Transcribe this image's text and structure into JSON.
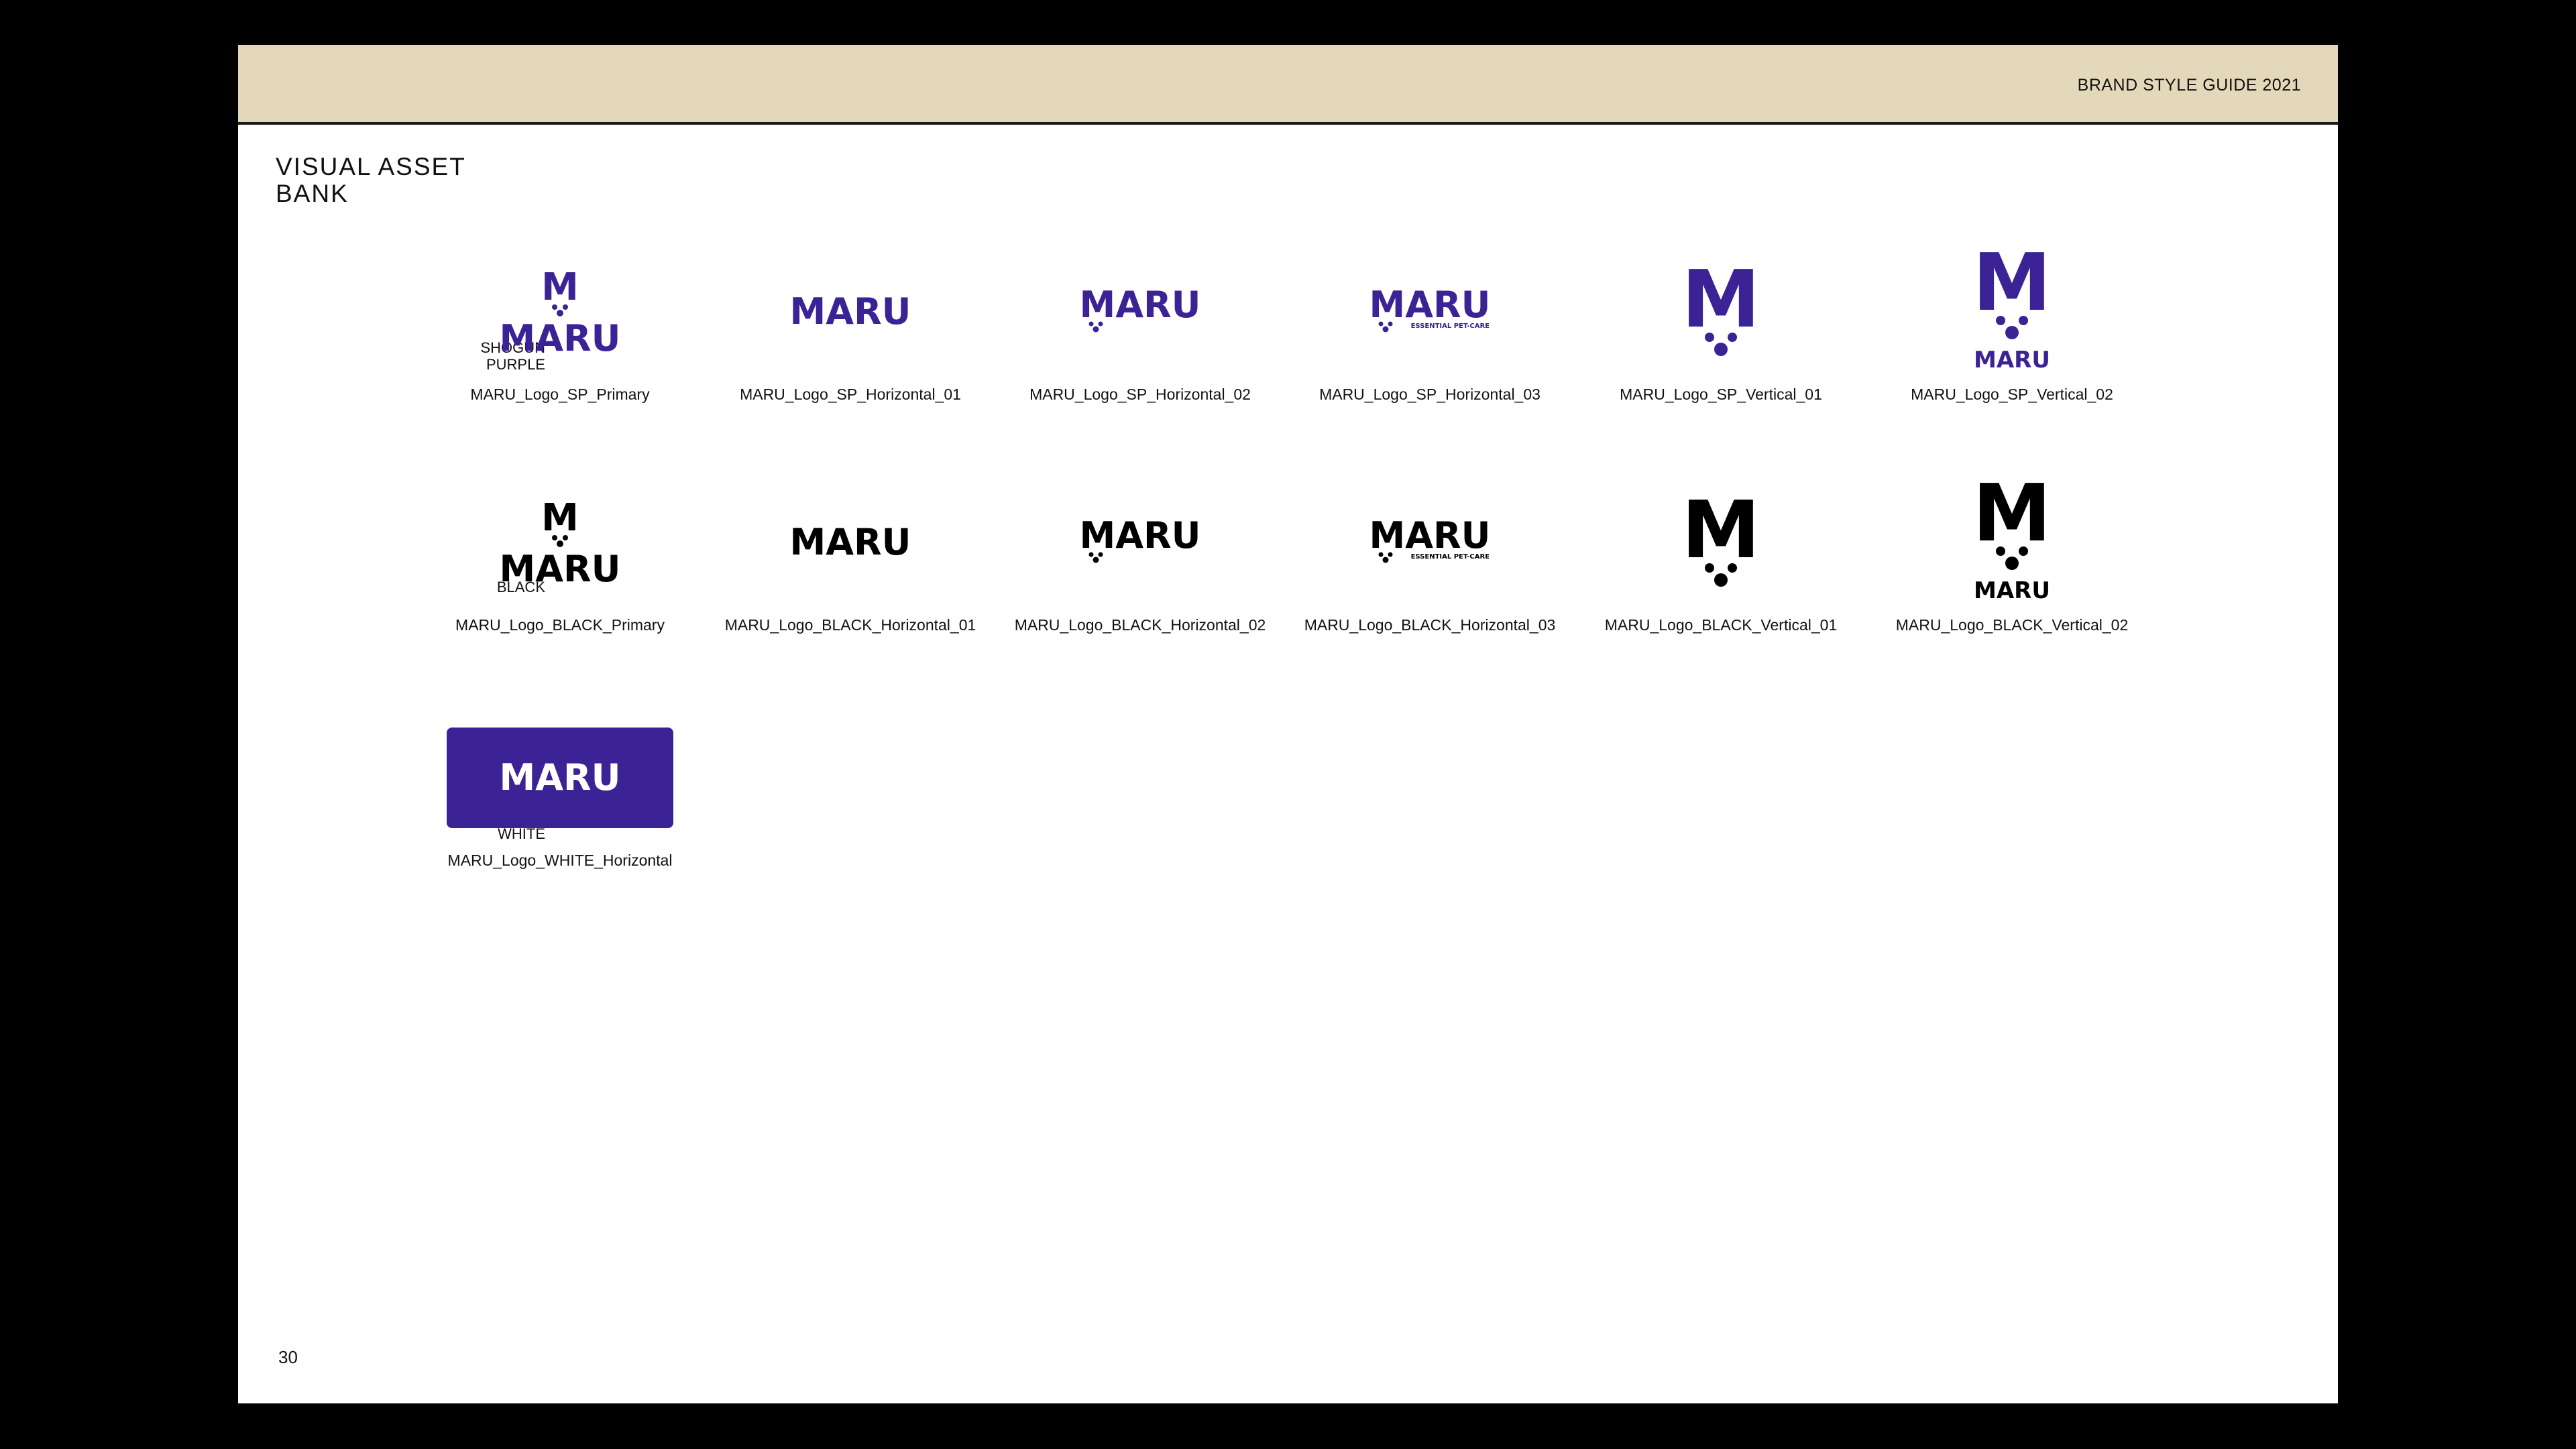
{
  "header": {
    "title": "BRAND STYLE GUIDE 2021"
  },
  "page": {
    "title_line1": "VISUAL ASSET",
    "title_line2": "BANK",
    "number": "30"
  },
  "colors": {
    "purple": "#3b2396",
    "black": "#000000",
    "band": "#e3d8b9"
  },
  "logo": {
    "wordmark": "MARU",
    "initial": "M",
    "tagline": "ESSENTIAL PET-CARE"
  },
  "rows": {
    "purple": {
      "label_line1": "SHŌGUN",
      "label_line2": "PURPLE",
      "captions": [
        "MARU_Logo_SP_Primary",
        "MARU_Logo_SP_Horizontal_01",
        "MARU_Logo_SP_Horizontal_02",
        "MARU_Logo_SP_Horizontal_03",
        "MARU_Logo_SP_Vertical_01",
        "MARU_Logo_SP_Vertical_02"
      ]
    },
    "black": {
      "label": "BLACK",
      "captions": [
        "MARU_Logo_BLACK_Primary",
        "MARU_Logo_BLACK_Horizontal_01",
        "MARU_Logo_BLACK_Horizontal_02",
        "MARU_Logo_BLACK_Horizontal_03",
        "MARU_Logo_BLACK_Vertical_01",
        "MARU_Logo_BLACK_Vertical_02"
      ]
    },
    "white": {
      "label": "WHITE",
      "captions": [
        "MARU_Logo_WHITE_Horizontal"
      ]
    }
  }
}
